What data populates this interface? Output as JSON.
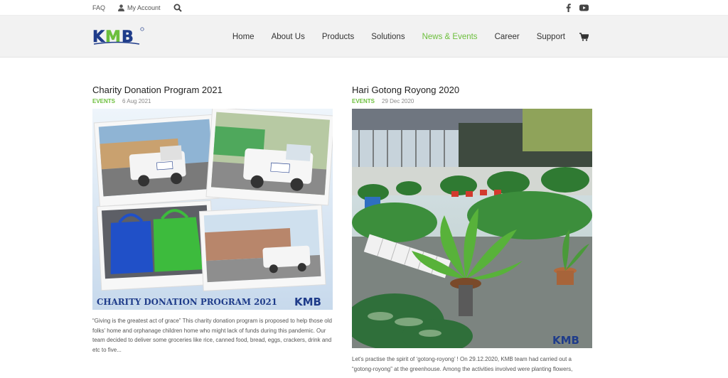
{
  "topbar": {
    "faq": "FAQ",
    "account": "My Account",
    "icons": [
      "user-icon",
      "search-icon",
      "facebook-icon",
      "youtube-icon"
    ]
  },
  "brand": {
    "logo_text": "KMB",
    "logo_colors": [
      "#1f3c8a",
      "#6cbf3c"
    ]
  },
  "nav": {
    "items": [
      {
        "label": "Home"
      },
      {
        "label": "About Us"
      },
      {
        "label": "Products"
      },
      {
        "label": "Solutions"
      },
      {
        "label": "News & Events",
        "active": true
      },
      {
        "label": "Career"
      },
      {
        "label": "Support"
      }
    ],
    "cart_icon": "cart-icon",
    "active_color": "#6cbf3c"
  },
  "posts": [
    {
      "title": "Charity Donation Program 2021",
      "category": "EVENTS",
      "date": "6 Aug 2021",
      "image_caption": "CHARITY DONATION PROGRAM 2021",
      "image_logo": "KMB",
      "excerpt": "“Giving is the greatest act of grace” This charity donation program is proposed to help those old folks' home and orphanage children home who might lack of funds during this pandemic. Our team decided to deliver some groceries like rice, canned food, bread, eggs, crackers, drink and etc to five..."
    },
    {
      "title": "Hari Gotong Royong 2020",
      "category": "EVENTS",
      "date": "29 Dec 2020",
      "image_logo": "KMB",
      "excerpt": "Let's practise the spirit of ‘gotong-royong’ ! On 29.12.2020, KMB team had carried out a “gotong-royong” at the greenhouse. Among the activities involved were planting flowers,"
    }
  ]
}
